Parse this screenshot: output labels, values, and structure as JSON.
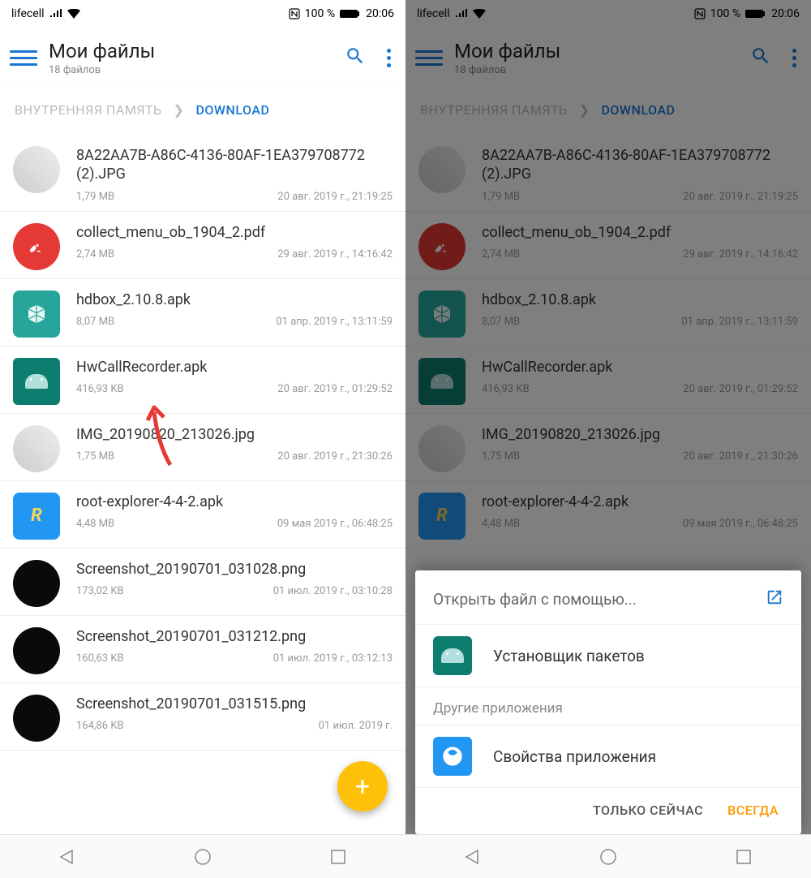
{
  "status": {
    "carrier": "lifecell",
    "battery_pct": "100 %",
    "time": "20:06"
  },
  "appbar": {
    "title": "Мои файлы",
    "subtitle": "18 файлов"
  },
  "breadcrumb": {
    "parent": "ВНУТРЕННЯЯ ПАМЯТЬ",
    "current": "DOWNLOAD"
  },
  "files": [
    {
      "name": "8A22AA7B-A86C-4136-80AF-1EA379708772 (2).JPG",
      "size": "1,79 MB",
      "date": "20 авг. 2019 г., 21:19:25",
      "icon": "img"
    },
    {
      "name": "collect_menu_ob_1904_2.pdf",
      "size": "2,74 MB",
      "date": "29 авг. 2019 г., 14:16:42",
      "icon": "pdf"
    },
    {
      "name": "hdbox_2.10.8.apk",
      "size": "8,07 MB",
      "date": "01 апр. 2019 г., 13:11:59",
      "icon": "apk-teal"
    },
    {
      "name": "HwCallRecorder.apk",
      "size": "416,93 KB",
      "date": "20 авг. 2019 г., 01:29:52",
      "icon": "apk-green"
    },
    {
      "name": "IMG_20190820_213026.jpg",
      "size": "1,75 MB",
      "date": "20 авг. 2019 г., 21:30:26",
      "icon": "img"
    },
    {
      "name": "root-explorer-4-4-2.apk",
      "size": "4,48 MB",
      "date": "09 мая 2019 г., 06:48:25",
      "icon": "root"
    },
    {
      "name": "Screenshot_20190701_031028.png",
      "size": "173,02 KB",
      "date": "01 июл. 2019 г., 03:10:28",
      "icon": "dark"
    },
    {
      "name": "Screenshot_20190701_031212.png",
      "size": "160,63 KB",
      "date": "01 июл. 2019 г., 03:12:13",
      "icon": "dark"
    },
    {
      "name": "Screenshot_20190701_031515.png",
      "size": "164,86 KB",
      "date": "01 июл. 2019 г.",
      "icon": "dark"
    }
  ],
  "sheet": {
    "title": "Открыть файл с помощью...",
    "option1": "Установщик пакетов",
    "other_section": "Другие приложения",
    "option2": "Свойства приложения",
    "once": "ТОЛЬКО СЕЙЧАС",
    "always": "ВСЕГДА"
  }
}
